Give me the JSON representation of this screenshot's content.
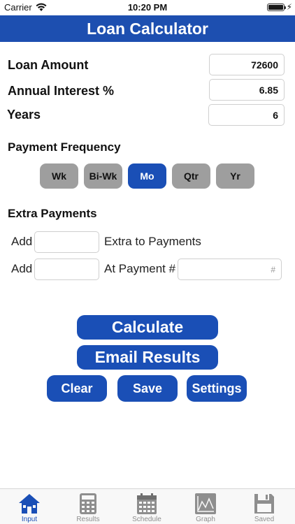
{
  "status_bar": {
    "carrier": "Carrier",
    "time": "10:20 PM"
  },
  "app": {
    "title": "Loan Calculator"
  },
  "loan": {
    "amount_label": "Loan Amount",
    "amount_value": "72600",
    "rate_label": "Annual Interest %",
    "rate_value": "6.85",
    "years_label": "Years",
    "years_value": "6"
  },
  "frequency": {
    "title": "Payment Frequency",
    "options": [
      "Wk",
      "Bi-Wk",
      "Mo",
      "Qtr",
      "Yr"
    ],
    "selected": "Mo"
  },
  "extra": {
    "title": "Extra Payments",
    "add_label": "Add",
    "extra_to_payments_label": "Extra to Payments",
    "at_payment_label": "At Payment #",
    "payment_number_placeholder": "#",
    "add_value_1": "",
    "add_value_2": "",
    "payment_number_value": ""
  },
  "actions": {
    "calculate": "Calculate",
    "email": "Email Results",
    "clear": "Clear",
    "save": "Save",
    "settings": "Settings"
  },
  "tabs": [
    {
      "label": "Input",
      "icon": "house-icon",
      "active": true
    },
    {
      "label": "Results",
      "icon": "calculator-icon",
      "active": false
    },
    {
      "label": "Schedule",
      "icon": "calendar-icon",
      "active": false
    },
    {
      "label": "Graph",
      "icon": "graph-icon",
      "active": false
    },
    {
      "label": "Saved",
      "icon": "floppy-disk-icon",
      "active": false
    }
  ],
  "colors": {
    "brand": "#1d4fb0",
    "inactive_segment": "#9e9e9e",
    "tab_inactive": "#8e8e8e"
  }
}
